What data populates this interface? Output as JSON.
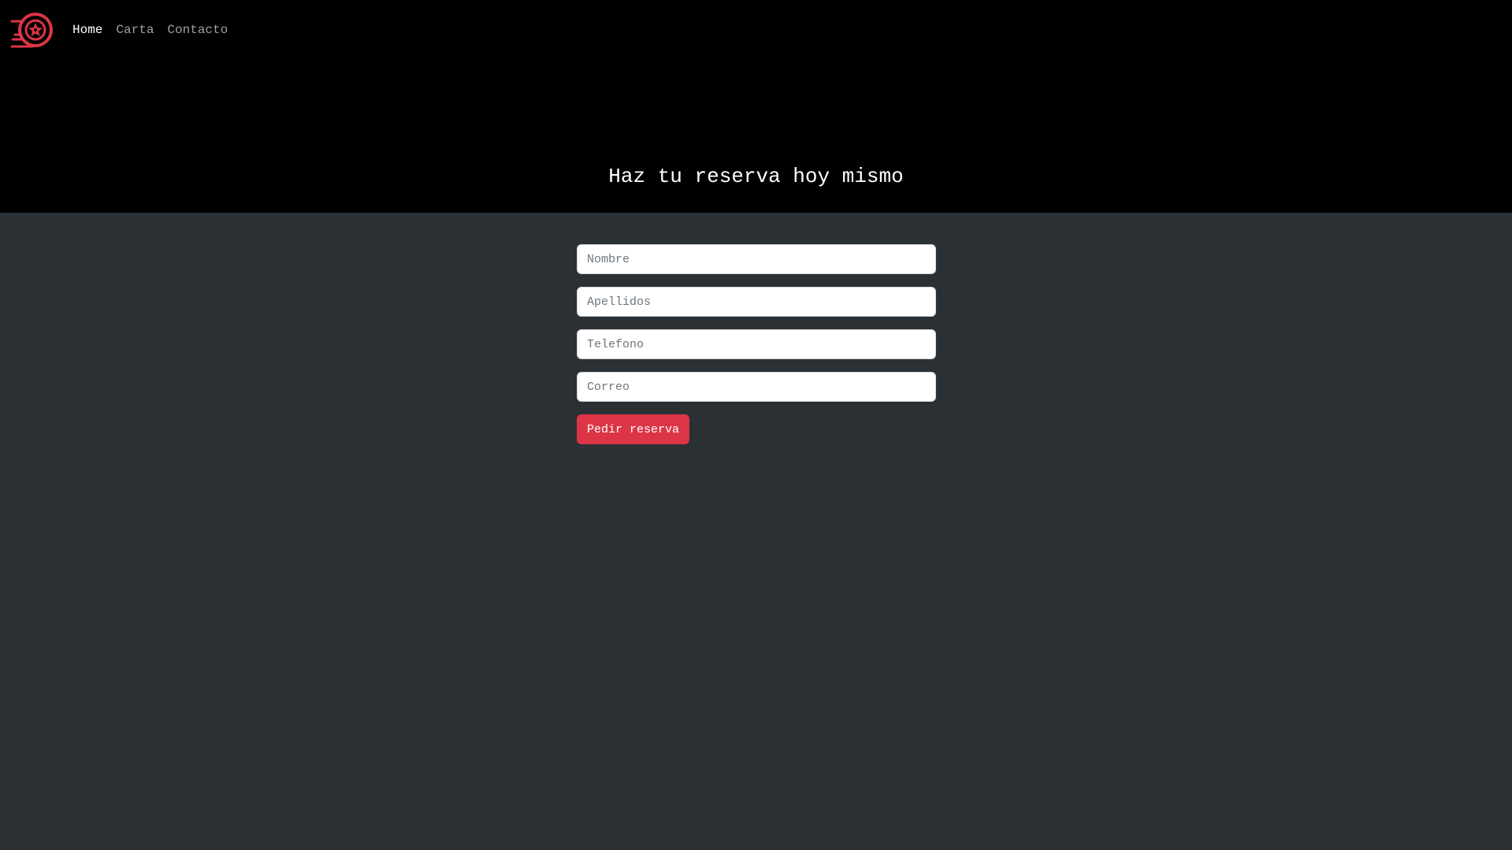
{
  "nav": {
    "logo_icon": "tire-wheel-icon",
    "links": [
      {
        "label": "Home",
        "active": true
      },
      {
        "label": "Carta",
        "active": false
      },
      {
        "label": "Contacto",
        "active": false
      }
    ]
  },
  "hero": {
    "title": "Haz tu reserva hoy mismo"
  },
  "form": {
    "fields": [
      {
        "placeholder": "Nombre",
        "value": ""
      },
      {
        "placeholder": "Apellidos",
        "value": ""
      },
      {
        "placeholder": "Telefono",
        "value": ""
      },
      {
        "placeholder": "Correo",
        "value": ""
      }
    ],
    "submit_label": "Pedir reserva"
  },
  "colors": {
    "hero_background": "#000000",
    "page_background": "#2b3035",
    "accent": "#dc3545",
    "nav_active": "#ffffff",
    "nav_inactive": "#9aa0a6"
  }
}
